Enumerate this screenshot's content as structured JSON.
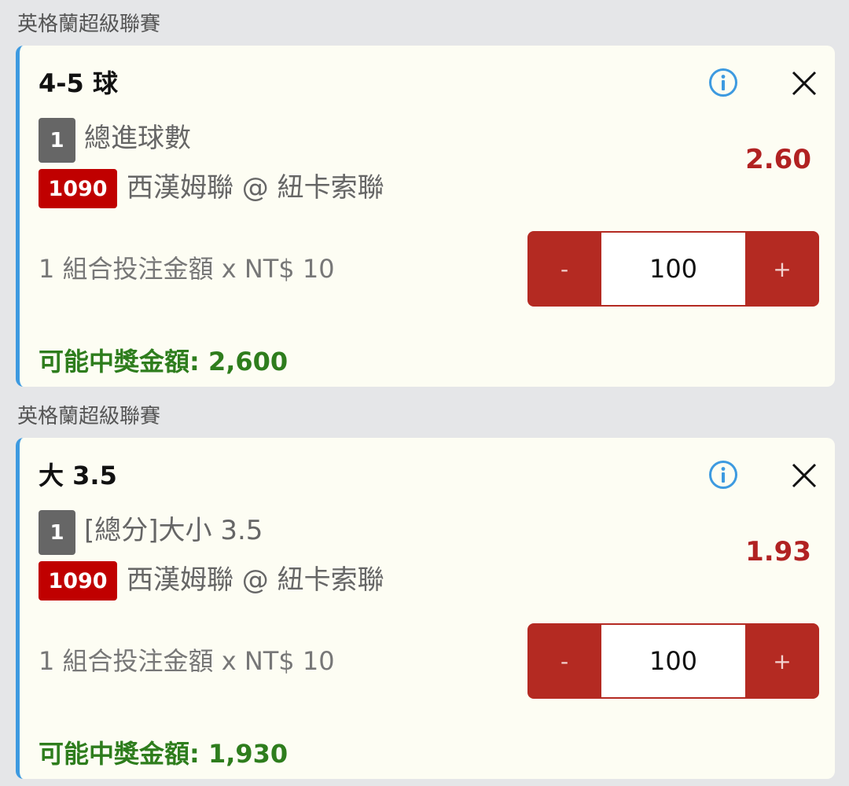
{
  "bets": [
    {
      "league": "英格蘭超級聯賽",
      "selection": "4-5 球",
      "leg_count": "1",
      "market": "總進球數",
      "match_code": "1090",
      "match": "西漢姆聯 @ 紐卡索聯",
      "odds": "2.60",
      "stake_desc": "1 組合投注金額 x NT$ 10",
      "stake_minus": "-",
      "stake_value": "100",
      "stake_plus": "+",
      "payout": "可能中獎金額: 2,600"
    },
    {
      "league": "英格蘭超級聯賽",
      "selection": "大 3.5",
      "leg_count": "1",
      "market": "[總分]大小 3.5",
      "match_code": "1090",
      "match": "西漢姆聯 @ 紐卡索聯",
      "odds": "1.93",
      "stake_desc": "1 組合投注金額 x NT$ 10",
      "stake_minus": "-",
      "stake_value": "100",
      "stake_plus": "+",
      "payout": "可能中獎金額: 1,930"
    }
  ],
  "icons": {
    "info": "info-icon",
    "close": "close-icon"
  },
  "colors": {
    "accent": "#3d9ae0",
    "odds": "#b12222",
    "stepper": "#b42a22",
    "payout": "#2e7d1d",
    "match_badge": "#c00000"
  }
}
